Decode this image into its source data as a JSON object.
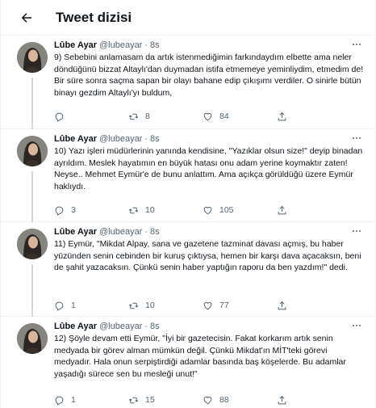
{
  "header": {
    "title": "Tweet dizisi",
    "back_icon": "arrow-left-icon"
  },
  "author": {
    "name": "Lûbe Ayar",
    "handle": "@lubeayar",
    "separator": "·"
  },
  "tweets": [
    {
      "time": "8s",
      "text": "9) Sebebini anlamasam da artık istenmediğimin farkındaydım elbette ama neler döndüğünü bizzat Altaylı'dan duymadan istifa etmemeye yeminliydim, etmedim de! Bir süre sonra saçma sapan bir olayı bahane edip çıkışımı verdiler. O sinirle bütün binayı gezdim Altaylı'yı buldum,",
      "replies": "",
      "retweets": "8",
      "likes": "84"
    },
    {
      "time": "8s",
      "text": "10) Yazı işleri müdürlerinin yanında kendisine, \"Yazıklar olsun size!\" deyip binadan ayrıldım. Meslek hayatımın en büyük hatası onu adam yerine koymaktır zaten! Neyse.. Mehmet Eymür'e de bunu anlattım. Ama açıkça görüldüğü üzere Eymür haklıydı.",
      "replies": "3",
      "retweets": "10",
      "likes": "105"
    },
    {
      "time": "8s",
      "text": "11) Eymür, \"Mikdat Alpay, sana ve gazetene tazminat davası açmış, bu haber yüzünden senin cebinden bir kuruş çıktıysa, hemen bir karşı dava açacaksın, beni de şahit yazacaksın. Çünkü senin haber yaptığın raporu da ben yazdım!\" dedi.",
      "replies": "1",
      "retweets": "10",
      "likes": "77"
    },
    {
      "time": "8s",
      "text": "12) Şöyle devam etti Eymür, \"İyi bir gazetecisin. Fakat korkarım artık senin medyada bir görev alman mümkün değil. Çünkü Mikdat'ın MİT'teki görevi medyadır. Hala onun serpiştirdiği adamlar basında baş köşelerde. Bu adamlar yaşadığı sürece sen bu mesleği unut!\"",
      "replies": "1",
      "retweets": "15",
      "likes": "88"
    }
  ],
  "icons": {
    "reply": "reply-icon",
    "retweet": "retweet-icon",
    "like": "heart-icon",
    "share": "share-icon",
    "more": "more-options-icon"
  },
  "colors": {
    "text": "#0f1419",
    "secondary": "#536471",
    "divider": "#eff3f4"
  }
}
